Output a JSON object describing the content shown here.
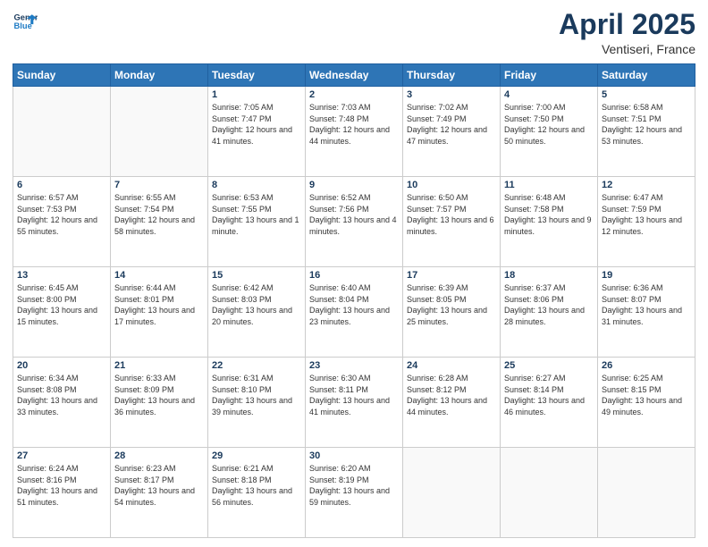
{
  "header": {
    "logo_line1": "General",
    "logo_line2": "Blue",
    "month_title": "April 2025",
    "location": "Ventiseri, France"
  },
  "days_of_week": [
    "Sunday",
    "Monday",
    "Tuesday",
    "Wednesday",
    "Thursday",
    "Friday",
    "Saturday"
  ],
  "weeks": [
    [
      {
        "num": "",
        "sunrise": "",
        "sunset": "",
        "daylight": ""
      },
      {
        "num": "",
        "sunrise": "",
        "sunset": "",
        "daylight": ""
      },
      {
        "num": "1",
        "sunrise": "Sunrise: 7:05 AM",
        "sunset": "Sunset: 7:47 PM",
        "daylight": "Daylight: 12 hours and 41 minutes."
      },
      {
        "num": "2",
        "sunrise": "Sunrise: 7:03 AM",
        "sunset": "Sunset: 7:48 PM",
        "daylight": "Daylight: 12 hours and 44 minutes."
      },
      {
        "num": "3",
        "sunrise": "Sunrise: 7:02 AM",
        "sunset": "Sunset: 7:49 PM",
        "daylight": "Daylight: 12 hours and 47 minutes."
      },
      {
        "num": "4",
        "sunrise": "Sunrise: 7:00 AM",
        "sunset": "Sunset: 7:50 PM",
        "daylight": "Daylight: 12 hours and 50 minutes."
      },
      {
        "num": "5",
        "sunrise": "Sunrise: 6:58 AM",
        "sunset": "Sunset: 7:51 PM",
        "daylight": "Daylight: 12 hours and 53 minutes."
      }
    ],
    [
      {
        "num": "6",
        "sunrise": "Sunrise: 6:57 AM",
        "sunset": "Sunset: 7:53 PM",
        "daylight": "Daylight: 12 hours and 55 minutes."
      },
      {
        "num": "7",
        "sunrise": "Sunrise: 6:55 AM",
        "sunset": "Sunset: 7:54 PM",
        "daylight": "Daylight: 12 hours and 58 minutes."
      },
      {
        "num": "8",
        "sunrise": "Sunrise: 6:53 AM",
        "sunset": "Sunset: 7:55 PM",
        "daylight": "Daylight: 13 hours and 1 minute."
      },
      {
        "num": "9",
        "sunrise": "Sunrise: 6:52 AM",
        "sunset": "Sunset: 7:56 PM",
        "daylight": "Daylight: 13 hours and 4 minutes."
      },
      {
        "num": "10",
        "sunrise": "Sunrise: 6:50 AM",
        "sunset": "Sunset: 7:57 PM",
        "daylight": "Daylight: 13 hours and 6 minutes."
      },
      {
        "num": "11",
        "sunrise": "Sunrise: 6:48 AM",
        "sunset": "Sunset: 7:58 PM",
        "daylight": "Daylight: 13 hours and 9 minutes."
      },
      {
        "num": "12",
        "sunrise": "Sunrise: 6:47 AM",
        "sunset": "Sunset: 7:59 PM",
        "daylight": "Daylight: 13 hours and 12 minutes."
      }
    ],
    [
      {
        "num": "13",
        "sunrise": "Sunrise: 6:45 AM",
        "sunset": "Sunset: 8:00 PM",
        "daylight": "Daylight: 13 hours and 15 minutes."
      },
      {
        "num": "14",
        "sunrise": "Sunrise: 6:44 AM",
        "sunset": "Sunset: 8:01 PM",
        "daylight": "Daylight: 13 hours and 17 minutes."
      },
      {
        "num": "15",
        "sunrise": "Sunrise: 6:42 AM",
        "sunset": "Sunset: 8:03 PM",
        "daylight": "Daylight: 13 hours and 20 minutes."
      },
      {
        "num": "16",
        "sunrise": "Sunrise: 6:40 AM",
        "sunset": "Sunset: 8:04 PM",
        "daylight": "Daylight: 13 hours and 23 minutes."
      },
      {
        "num": "17",
        "sunrise": "Sunrise: 6:39 AM",
        "sunset": "Sunset: 8:05 PM",
        "daylight": "Daylight: 13 hours and 25 minutes."
      },
      {
        "num": "18",
        "sunrise": "Sunrise: 6:37 AM",
        "sunset": "Sunset: 8:06 PM",
        "daylight": "Daylight: 13 hours and 28 minutes."
      },
      {
        "num": "19",
        "sunrise": "Sunrise: 6:36 AM",
        "sunset": "Sunset: 8:07 PM",
        "daylight": "Daylight: 13 hours and 31 minutes."
      }
    ],
    [
      {
        "num": "20",
        "sunrise": "Sunrise: 6:34 AM",
        "sunset": "Sunset: 8:08 PM",
        "daylight": "Daylight: 13 hours and 33 minutes."
      },
      {
        "num": "21",
        "sunrise": "Sunrise: 6:33 AM",
        "sunset": "Sunset: 8:09 PM",
        "daylight": "Daylight: 13 hours and 36 minutes."
      },
      {
        "num": "22",
        "sunrise": "Sunrise: 6:31 AM",
        "sunset": "Sunset: 8:10 PM",
        "daylight": "Daylight: 13 hours and 39 minutes."
      },
      {
        "num": "23",
        "sunrise": "Sunrise: 6:30 AM",
        "sunset": "Sunset: 8:11 PM",
        "daylight": "Daylight: 13 hours and 41 minutes."
      },
      {
        "num": "24",
        "sunrise": "Sunrise: 6:28 AM",
        "sunset": "Sunset: 8:12 PM",
        "daylight": "Daylight: 13 hours and 44 minutes."
      },
      {
        "num": "25",
        "sunrise": "Sunrise: 6:27 AM",
        "sunset": "Sunset: 8:14 PM",
        "daylight": "Daylight: 13 hours and 46 minutes."
      },
      {
        "num": "26",
        "sunrise": "Sunrise: 6:25 AM",
        "sunset": "Sunset: 8:15 PM",
        "daylight": "Daylight: 13 hours and 49 minutes."
      }
    ],
    [
      {
        "num": "27",
        "sunrise": "Sunrise: 6:24 AM",
        "sunset": "Sunset: 8:16 PM",
        "daylight": "Daylight: 13 hours and 51 minutes."
      },
      {
        "num": "28",
        "sunrise": "Sunrise: 6:23 AM",
        "sunset": "Sunset: 8:17 PM",
        "daylight": "Daylight: 13 hours and 54 minutes."
      },
      {
        "num": "29",
        "sunrise": "Sunrise: 6:21 AM",
        "sunset": "Sunset: 8:18 PM",
        "daylight": "Daylight: 13 hours and 56 minutes."
      },
      {
        "num": "30",
        "sunrise": "Sunrise: 6:20 AM",
        "sunset": "Sunset: 8:19 PM",
        "daylight": "Daylight: 13 hours and 59 minutes."
      },
      {
        "num": "",
        "sunrise": "",
        "sunset": "",
        "daylight": ""
      },
      {
        "num": "",
        "sunrise": "",
        "sunset": "",
        "daylight": ""
      },
      {
        "num": "",
        "sunrise": "",
        "sunset": "",
        "daylight": ""
      }
    ]
  ]
}
